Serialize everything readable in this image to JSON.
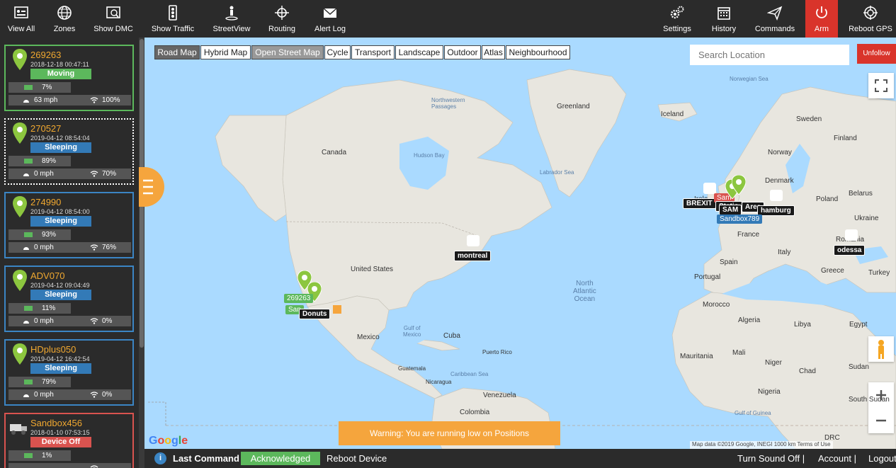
{
  "toolbar": {
    "left": [
      {
        "label": "View All",
        "icon": "view-all-icon"
      },
      {
        "label": "Zones",
        "icon": "globe-icon"
      },
      {
        "label": "Show DMC",
        "icon": "dmc-icon"
      },
      {
        "label": "Show Traffic",
        "icon": "traffic-light-icon"
      },
      {
        "label": "StreetView",
        "icon": "pegman-icon"
      },
      {
        "label": "Routing",
        "icon": "routing-icon"
      },
      {
        "label": "Alert Log",
        "icon": "envelope-icon"
      }
    ],
    "right": [
      {
        "label": "Settings",
        "icon": "gears-icon"
      },
      {
        "label": "History",
        "icon": "calendar-icon"
      },
      {
        "label": "Commands",
        "icon": "paper-plane-icon"
      },
      {
        "label": "Arm",
        "icon": "power-icon"
      },
      {
        "label": "Reboot GPS",
        "icon": "reboot-icon"
      }
    ]
  },
  "devices": [
    {
      "name": "269263",
      "timestamp": "2018-12-18 00:47:11",
      "status": "Moving",
      "battery": "7%",
      "speed": "63 mph",
      "signal": "100%"
    },
    {
      "name": "270527",
      "timestamp": "2019-04-12 08:54:04",
      "status": "Sleeping",
      "battery": "89%",
      "speed": "0 mph",
      "signal": "70%"
    },
    {
      "name": "274990",
      "timestamp": "2019-04-12 08:54:00",
      "status": "Sleeping",
      "battery": "93%",
      "speed": "0 mph",
      "signal": "76%"
    },
    {
      "name": "ADV070",
      "timestamp": "2019-04-12 09:04:49",
      "status": "Sleeping",
      "battery": "11%",
      "speed": "0 mph",
      "signal": "0%"
    },
    {
      "name": "HDplus050",
      "timestamp": "2019-04-12 16:42:54",
      "status": "Sleeping",
      "battery": "79%",
      "speed": "0 mph",
      "signal": "0%"
    },
    {
      "name": "Sandbox456",
      "timestamp": "2018-01-10 07:53:15",
      "status": "Device Off",
      "battery": "1%",
      "speed": "",
      "signal": ""
    }
  ],
  "map": {
    "types": [
      "Road Map",
      "Hybrid Map",
      "Open Street Map",
      "Cycle",
      "Transport",
      "Landscape",
      "Outdoor",
      "Atlas",
      "Neighbourhood"
    ],
    "search_placeholder": "Search Location",
    "unfollow_label": "Unfollow",
    "warning": "Warning: You are running low on Positions",
    "google": "Google",
    "attribution": "Map data ©2019 Google, INEGI   1000 km         Terms of Use",
    "labels": {
      "greenland": "Greenland",
      "iceland": "Iceland",
      "canada": "Canada",
      "hudson": "Hudson Bay",
      "labrador": "Labrador Sea",
      "nwp": "Northwestern\nPassages",
      "norwegian": "Norwegian Sea",
      "sweden": "Sweden",
      "finland": "Finland",
      "norway": "Norway",
      "denmark": "Denmark",
      "belarus": "Belarus",
      "poland": "Poland",
      "ukraine": "Ukraine",
      "romania": "Romania",
      "italy": "Italy",
      "spain": "Spain",
      "portugal": "Portugal",
      "france": "France",
      "greece": "Greece",
      "turkey": "Turkey",
      "us": "United States",
      "mexico": "Mexico",
      "gulf": "Gulf of\nMexico",
      "cuba": "Cuba",
      "puerto": "Puerto Rico",
      "guatemala": "Guatemala",
      "nicaragua": "Nicaragua",
      "caribbean": "Caribbean Sea",
      "venezuela": "Venezuela",
      "colombia": "Colombia",
      "atlantic": "North\nAtlantic\nOcean",
      "morocco": "Morocco",
      "algeria": "Algeria",
      "libya": "Libya",
      "egypt": "Egypt",
      "mauritania": "Mauritania",
      "mali": "Mali",
      "niger": "Niger",
      "chad": "Chad",
      "sudan": "Sudan",
      "nigeria": "Nigeria",
      "southsudan": "South Sudan",
      "drc": "DRC",
      "guinea": "Gulf of Guinea",
      "ireland": "Irela"
    },
    "tags": {
      "montreal": "montreal",
      "brexit": "BREXIT",
      "sam": "SAM",
      "hamburg": "hamburg",
      "sandbox789": "Sandbox789",
      "odessa": "odessa",
      "donuts": "Donuts",
      "tag269263": "269263",
      "san": "San",
      "samuk": "Sam",
      "area": "Area",
      "station": "Statio"
    }
  },
  "bottom": {
    "info": "i",
    "last_command": "Last Command",
    "ack": "Acknowledged",
    "reboot": "Reboot Device",
    "sound": "Turn Sound Off",
    "account": "Account",
    "logout": "Logout"
  }
}
